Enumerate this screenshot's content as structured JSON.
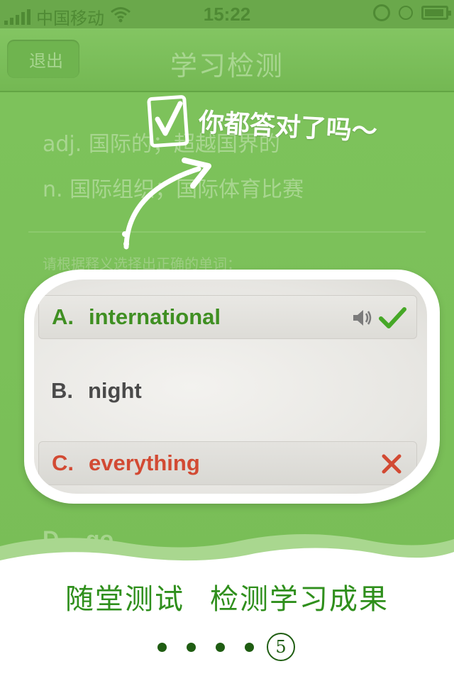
{
  "status_bar": {
    "carrier": "中国移动",
    "time": "15:22",
    "icons": [
      "signal-icon",
      "wifi-icon",
      "rotation-lock-icon",
      "alarm-icon",
      "battery-icon"
    ]
  },
  "nav": {
    "back_label": "退出",
    "title": "学习检测"
  },
  "background": {
    "definition_1": "adj. 国际的；超越国界的",
    "definition_2": "n.  国际组织；国际体育比赛",
    "prompt": "请根据释义选择出正确的单词：",
    "option_d_letter": "D.",
    "option_d_word": "go"
  },
  "annotation": {
    "text": "你都答对了吗～",
    "check_icon": "checkbox-icon"
  },
  "options": [
    {
      "letter": "A.",
      "word": "international",
      "state": "correct",
      "color": "#3f8f22"
    },
    {
      "letter": "B.",
      "word": "night",
      "state": "neutral",
      "color": "#4a4a4a"
    },
    {
      "letter": "C.",
      "word": "everything",
      "state": "wrong",
      "color": "#d24a33"
    }
  ],
  "footer": {
    "caption_1": "随堂测试",
    "caption_2": "检测学习成果",
    "current_page": "5"
  },
  "colors": {
    "brand_green": "#7ec35c",
    "correct": "#3f8f22",
    "wrong": "#d24a33",
    "caption": "#2f8f1c"
  }
}
